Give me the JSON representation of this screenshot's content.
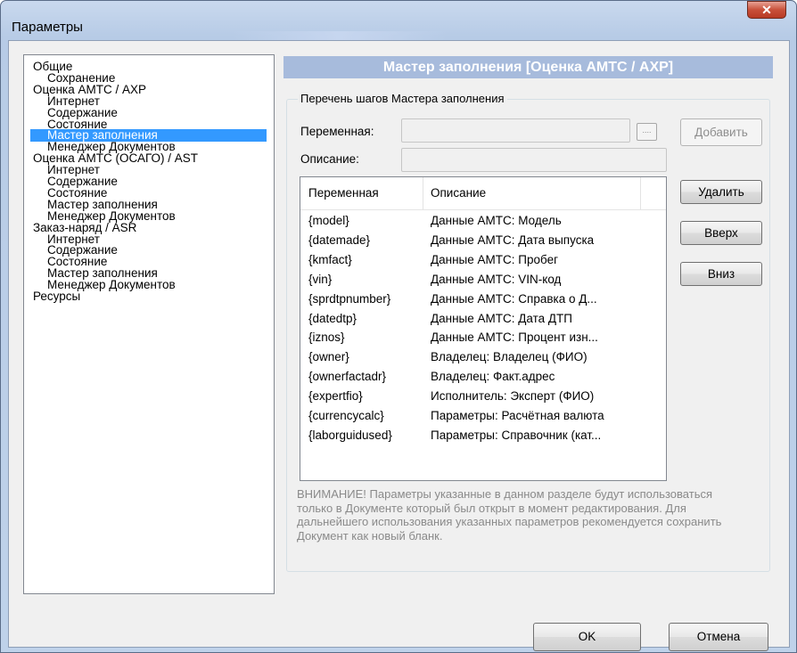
{
  "window": {
    "title": "Параметры",
    "close_glyph": "✕"
  },
  "tree": {
    "items": [
      {
        "label": "Общие",
        "level": 0,
        "selected": false
      },
      {
        "label": "Сохранение",
        "level": 1,
        "selected": false
      },
      {
        "label": "Оценка АМТС / АХР",
        "level": 0,
        "selected": false
      },
      {
        "label": "Интернет",
        "level": 1,
        "selected": false
      },
      {
        "label": "Содержание",
        "level": 1,
        "selected": false
      },
      {
        "label": "Состояние",
        "level": 1,
        "selected": false
      },
      {
        "label": "Мастер заполнения",
        "level": 1,
        "selected": true
      },
      {
        "label": "Менеджер Документов",
        "level": 1,
        "selected": false
      },
      {
        "label": "Оценка АМТС (ОСАГО) / AST",
        "level": 0,
        "selected": false
      },
      {
        "label": "Интернет",
        "level": 1,
        "selected": false
      },
      {
        "label": "Содержание",
        "level": 1,
        "selected": false
      },
      {
        "label": "Состояние",
        "level": 1,
        "selected": false
      },
      {
        "label": "Мастер заполнения",
        "level": 1,
        "selected": false
      },
      {
        "label": "Менеджер Документов",
        "level": 1,
        "selected": false
      },
      {
        "label": "Заказ-наряд / ASR",
        "level": 0,
        "selected": false
      },
      {
        "label": "Интернет",
        "level": 1,
        "selected": false
      },
      {
        "label": "Содержание",
        "level": 1,
        "selected": false
      },
      {
        "label": "Состояние",
        "level": 1,
        "selected": false
      },
      {
        "label": "Мастер заполнения",
        "level": 1,
        "selected": false
      },
      {
        "label": "Менеджер Документов",
        "level": 1,
        "selected": false
      },
      {
        "label": "Ресурсы",
        "level": 0,
        "selected": false
      }
    ]
  },
  "panel": {
    "header": "Мастер заполнения [Оценка АМТС / АХР]",
    "group_title": "Перечень шагов Мастера заполнения",
    "variable_label": "Переменная:",
    "variable_value": "",
    "description_label": "Описание:",
    "description_value": "",
    "browse_label": "....",
    "add_label": "Добавить",
    "delete_label": "Удалить",
    "up_label": "Вверх",
    "down_label": "Вниз",
    "table": {
      "columns": [
        "Переменная",
        "Описание"
      ],
      "rows": [
        [
          "{model}",
          "Данные АМТС: Модель"
        ],
        [
          "{datemade}",
          "Данные АМТС: Дата выпуска"
        ],
        [
          "{kmfact}",
          "Данные АМТС: Пробег"
        ],
        [
          "{vin}",
          "Данные АМТС: VIN-код"
        ],
        [
          "{sprdtpnumber}",
          "Данные АМТС: Справка о Д..."
        ],
        [
          "{datedtp}",
          "Данные АМТС: Дата ДТП"
        ],
        [
          "{iznos}",
          "Данные АМТС: Процент изн..."
        ],
        [
          "{owner}",
          "Владелец: Владелец (ФИО)"
        ],
        [
          "{ownerfactadr}",
          "Владелец: Факт.адрес"
        ],
        [
          "{expertfio}",
          "Исполнитель: Эксперт (ФИО)"
        ],
        [
          "{currencycalc}",
          "Параметры: Расчётная валюта"
        ],
        [
          "{laborguidused}",
          "Параметры: Справочник (кат..."
        ]
      ]
    },
    "note": "ВНИМАНИЕ! Параметры указанные в данном разделе будут использоваться только в Документе который был открыт в момент редактирования. Для дальнейшего использования указанных параметров рекомендуется сохранить Документ как новый бланк."
  },
  "footer": {
    "ok_label": "OK",
    "cancel_label": "Отмена"
  }
}
